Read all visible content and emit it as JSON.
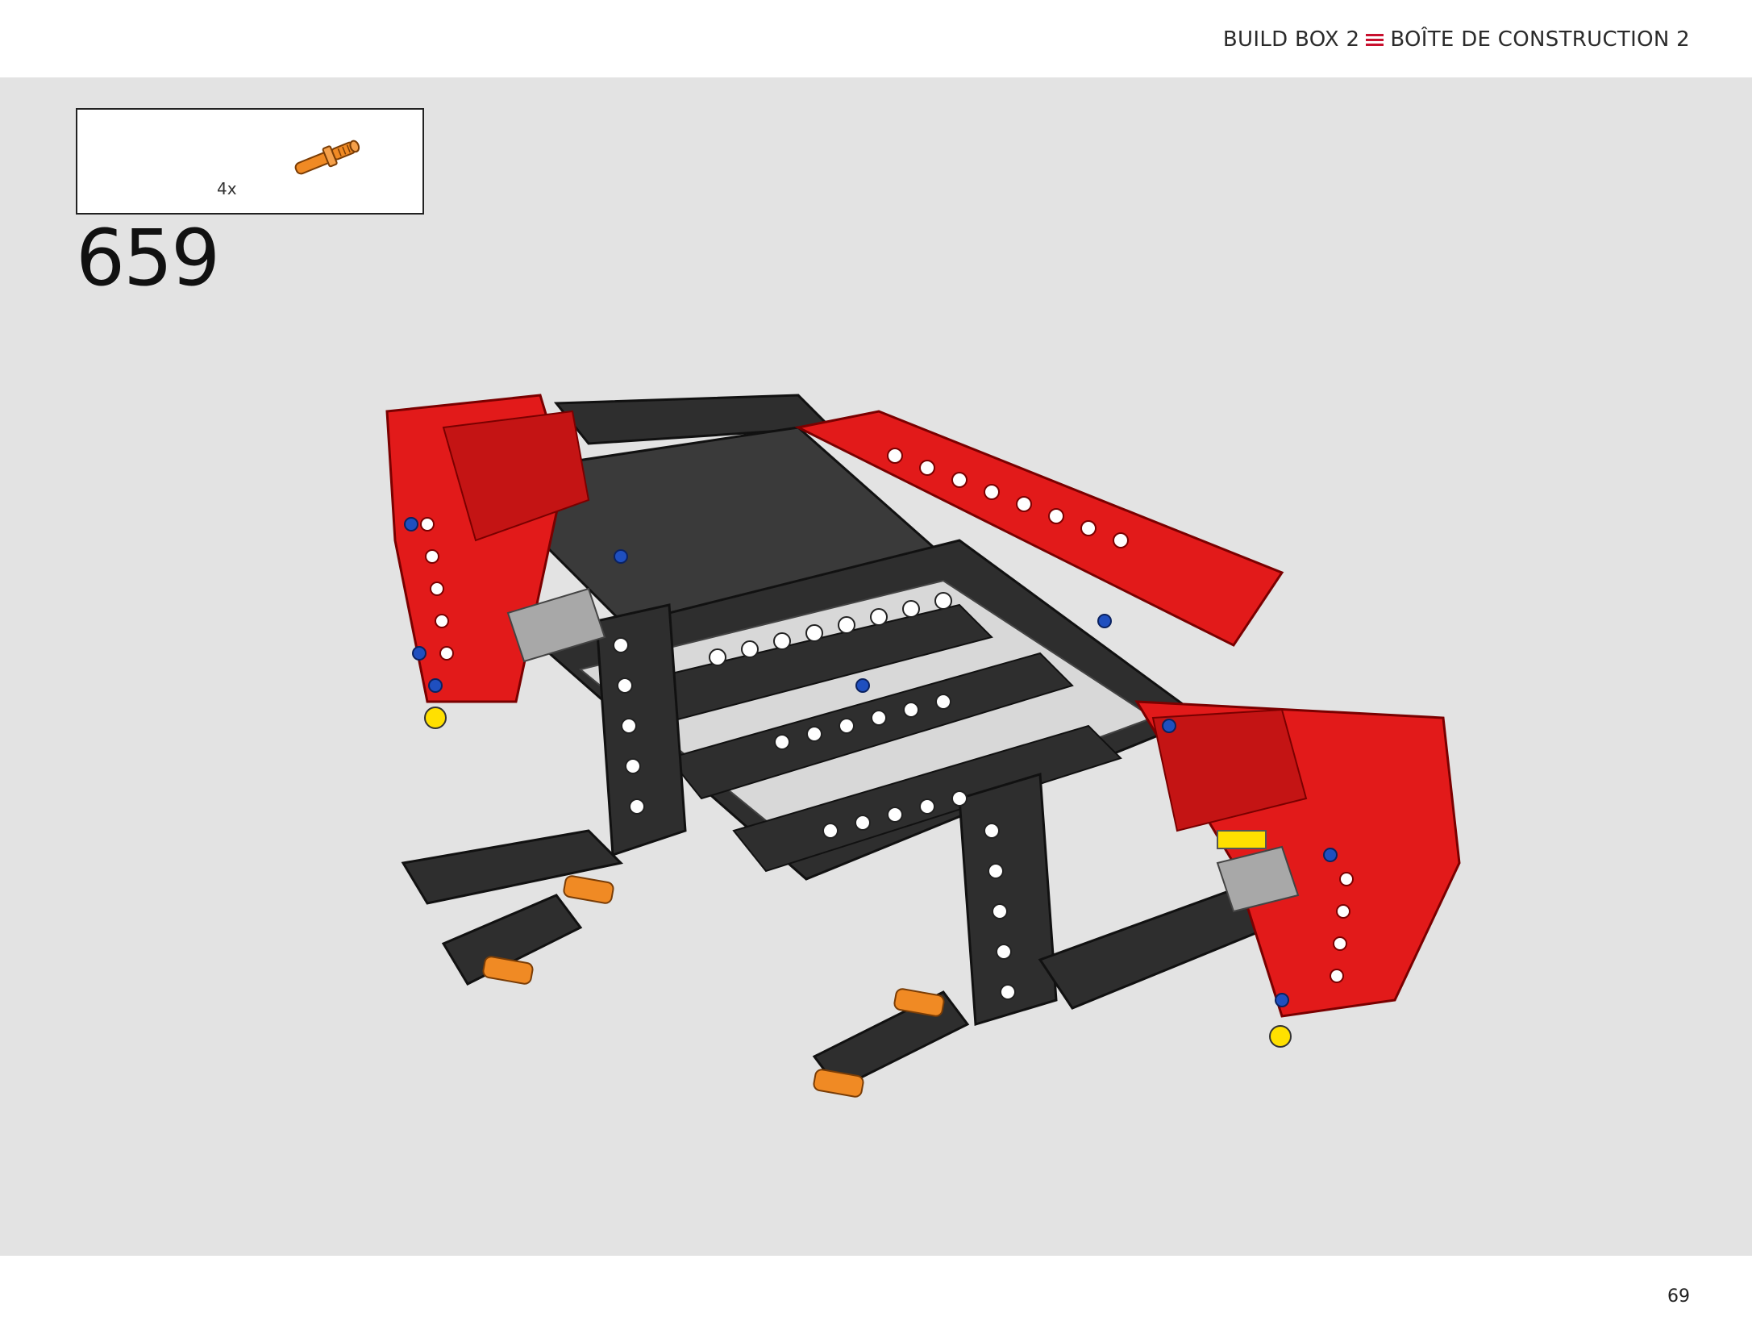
{
  "header": {
    "title_en": "BUILD BOX 2",
    "separator_icon": "triple-line-icon",
    "title_fr": "BOÎTE DE CONSTRUCTION 2",
    "accent_color": "#c8102e"
  },
  "parts_callout": {
    "quantity": "4x",
    "part_icon": "orange-axle-pin-icon",
    "part_color": "#f08a24"
  },
  "step": {
    "number": "659"
  },
  "footer": {
    "page_number": "69"
  },
  "colors": {
    "background": "#e3e3e3",
    "model_red": "#e21a1a",
    "model_black": "#2e2e2e",
    "model_gray": "#a8a8a8"
  }
}
